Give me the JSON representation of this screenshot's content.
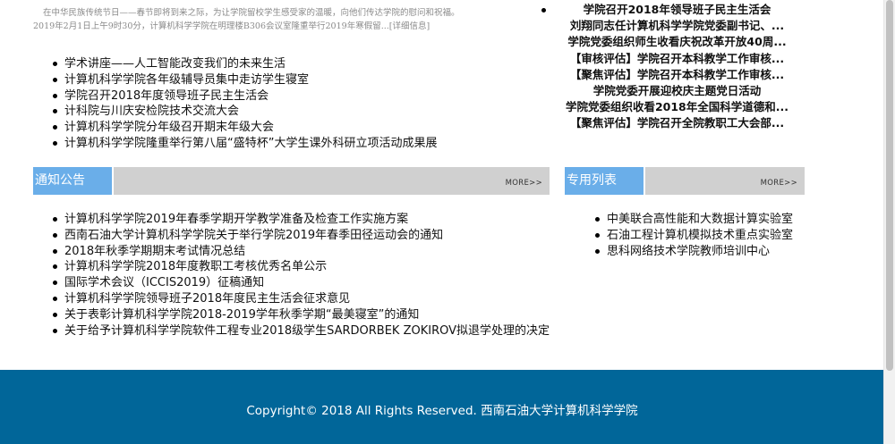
{
  "intro": {
    "line1": "在中华民族传统节日——春节即将到来之际，为让学院留校学生感受家的温暖，向他们传达学院的慰问和祝福。",
    "line2": "2019年2月1日上午9时30分，计算机科学学院在明理楼B306会议室隆重举行2019年寒假留...",
    "more_link": "[详细信息]"
  },
  "news_left": [
    "学术讲座——人工智能改变我们的未来生活",
    "计算机科学学院各年级辅导员集中走访学生寝室",
    "学院召开2018年度领导班子民主生活会",
    "计科院与川庆安检院技术交流大会",
    "计算机科学学院分年级召开期末年级大会",
    "计算机科学学院隆重举行第八届“盛特杯”大学生课外科研立项活动成果展"
  ],
  "news_right": [
    "学院召开2018年领导班子民主生活会",
    "刘翔同志任计算机科学学院党委副书记、...",
    "学院党委组织师生收看庆祝改革开放40周...",
    "【审核评估】学院召开本科教学工作审核...",
    "【聚焦评估】学院召开本科教学工作审核...",
    "学院党委开展迎校庆主题党日活动",
    "学院党委组织收看2018年全国科学道德和...",
    "【聚焦评估】学院召开全院教职工大会部..."
  ],
  "notice_section": {
    "title": "通知公告",
    "more": "MORE>>"
  },
  "notice_list": [
    "计算机科学学院2019年春季学期开学教学准备及检查工作实施方案",
    "西南石油大学计算机科学学院关于举行学院2019年春季田径运动会的通知",
    "2018年秋季学期期末考试情况总结",
    "计算机科学学院2018年度教职工考核优秀名单公示",
    "国际学术会议（ICCIS2019）征稿通知",
    "计算机科学学院领导班子2018年度民主生活会征求意见",
    "关于表彰计算机科学学院2018-2019学年秋季学期“最美寝室”的通知",
    "关于给予计算机科学学院软件工程专业2018级学生SARDORBEK ZOKIROV拟退学处理的决定"
  ],
  "special_section": {
    "title": "专用列表",
    "more": "MORE>>"
  },
  "special_list": [
    "中美联合高性能和大数据计算实验室",
    "石油工程计算机模拟技术重点实验室",
    "思科网络技术学院教师培训中心"
  ],
  "footer": {
    "copyright": "Copyright© 2018 All Rights Reserved. 西南石油大学计算机科学学院"
  },
  "colors": {
    "tab_blue": "#6aaee9",
    "bar_gray": "#d0d0d0",
    "footer_blue": "#016699"
  }
}
